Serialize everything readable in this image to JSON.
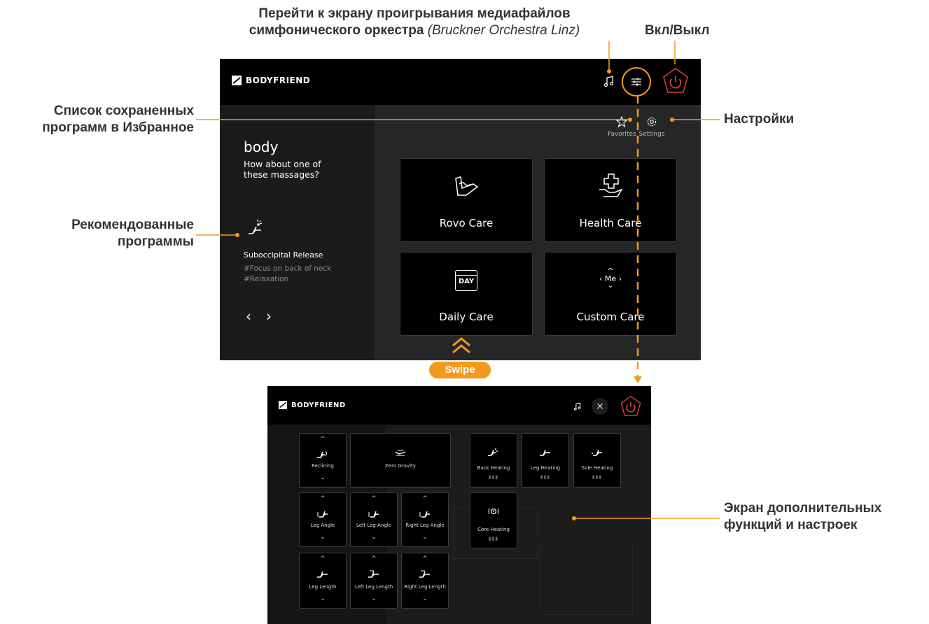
{
  "annotations": {
    "media_line1": "Перейти к экрану проигрывания медиафайлов",
    "media_line2": "симфонического оркестра",
    "media_line2_italic": "(Bruckner Orchestra Linz)",
    "power_label": "Вкл/Выкл",
    "favorites_line1": "Список сохраненных",
    "favorites_line2": "программ в Избранное",
    "settings_label": "Настройки",
    "recommended_line1": "Рекомендованные",
    "recommended_line2": "программы",
    "extra_line1": "Экран дополнительных",
    "extra_line2": "функций и настроек",
    "swipe": "Swipe"
  },
  "main_screen": {
    "brand": "BODYFRIEND",
    "favorites_label": "Favorites",
    "settings_label": "Settings",
    "greeting_name": "body",
    "greeting_line1": "How about one of",
    "greeting_line2": "these massages?",
    "program_name": "Suboccipital Release",
    "program_tag1": "#Focus on back of neck",
    "program_tag2": "#Relaxation",
    "prev": "‹",
    "next": "›",
    "cards": [
      {
        "label": "Rovo Care",
        "icon": "massage-chair-icon"
      },
      {
        "label": "Health Care",
        "icon": "hand-plus-icon"
      },
      {
        "label": "Daily Care",
        "icon": "calendar-day-icon",
        "icon_text": "DAY"
      },
      {
        "label": "Custom Care",
        "icon": "me-arrows-icon",
        "icon_text": "Me"
      }
    ]
  },
  "extra_screen": {
    "brand": "BODYFRIEND",
    "close": "×",
    "controls": {
      "reclining": "Reclining",
      "zero_gravity": "Zero Gravity",
      "leg_angle": "Leg Angle",
      "left_leg_angle": "Left Leg Angle",
      "right_leg_angle": "Right Leg Angle",
      "leg_length": "Leg Length",
      "left_leg_length": "Left Leg Length",
      "right_leg_length": "Right Leg Length"
    },
    "heating": {
      "back": "Back Heating",
      "leg": "Leg Heating",
      "sole": "Sole Heating",
      "core": "Core Heating"
    },
    "level_dots": "▮▮▮"
  },
  "colors": {
    "accent": "#f29a1c",
    "power": "#d8453a",
    "panel_left": "#1b1b1b",
    "panel_right": "#262626"
  }
}
